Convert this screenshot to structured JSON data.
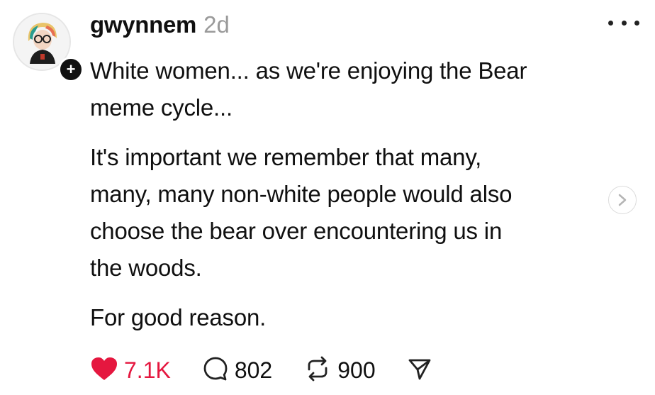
{
  "post": {
    "username": "gwynnem",
    "timestamp": "2d",
    "paragraphs": [
      "White women... as we're enjoying the Bear\nmeme cycle...",
      "It's important we remember that many,\nmany, many non-white people would also\nchoose the bear over encountering us in\nthe woods.",
      "For good reason."
    ]
  },
  "actions": {
    "likes": "7.1K",
    "comments": "802",
    "reposts": "900"
  },
  "icons": {
    "like": "heart-icon",
    "comment": "comment-icon",
    "repost": "repost-icon",
    "share": "send-icon",
    "more": "more-icon",
    "follow": "plus-icon",
    "carousel": "chevron-right-icon"
  },
  "colors": {
    "like_active": "#e5173f",
    "text": "#101010",
    "muted": "#9a9a9a"
  }
}
